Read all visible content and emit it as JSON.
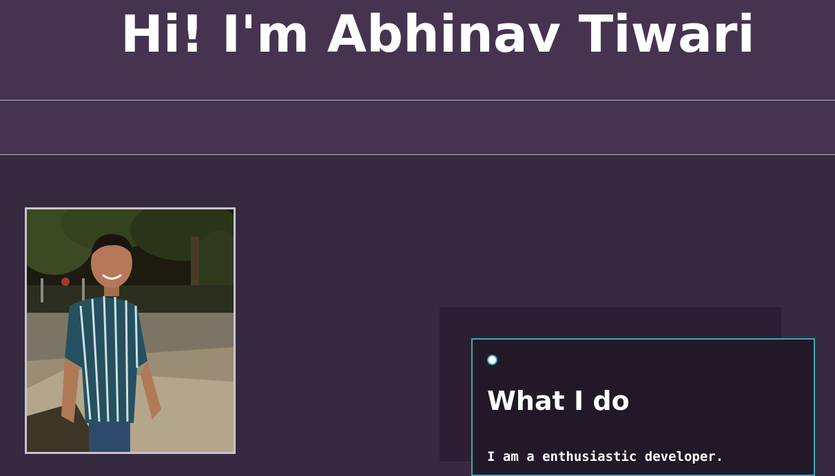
{
  "header": {
    "title": "Hi! I'm Abhinav Tiwari"
  },
  "profile": {
    "photo_description_icon": "profile-photo"
  },
  "card": {
    "heading": "What I do",
    "text": "I am a enthusiastic developer."
  },
  "colors": {
    "header_bg": "#463350",
    "main_bg": "#372a40",
    "card_outer_bg": "#2c1f33",
    "card_inner_bg": "#221827",
    "accent": "#3aaab8",
    "text": "#ffffff"
  }
}
